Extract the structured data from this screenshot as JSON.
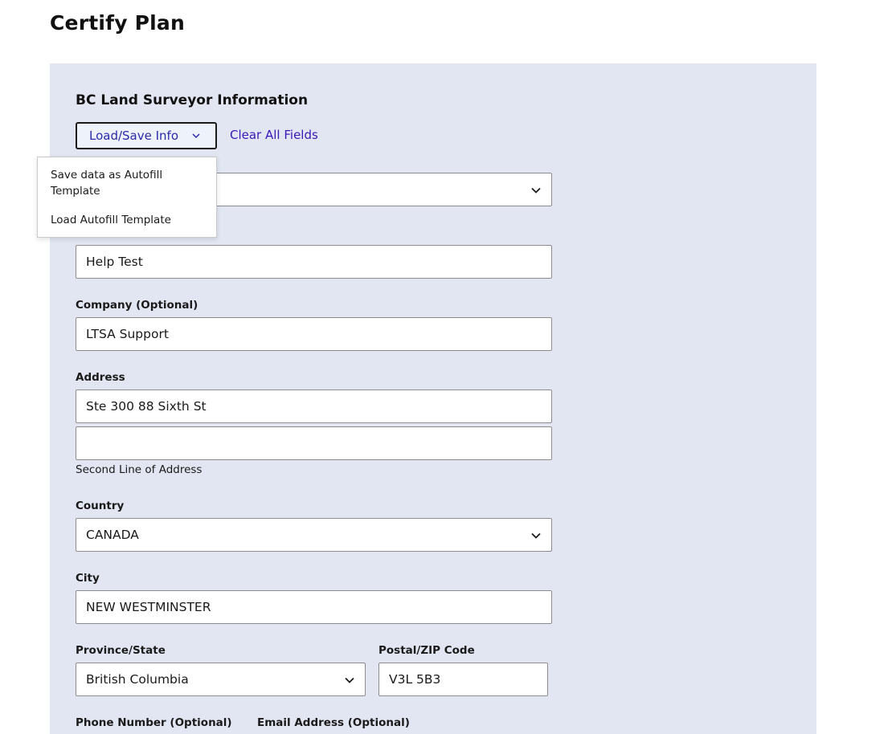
{
  "page": {
    "title": "Certify Plan"
  },
  "section": {
    "title": "BC Land Surveyor Information"
  },
  "toolbar": {
    "load_save_label": "Load/Save Info",
    "clear_all_label": "Clear All Fields"
  },
  "dropdown": {
    "items": [
      {
        "label": "Save data as Autofill Template"
      },
      {
        "label": "Load Autofill Template"
      }
    ]
  },
  "form": {
    "surveyor_select": {
      "value": ""
    },
    "name": {
      "value": "Help Test"
    },
    "company": {
      "label": "Company (Optional)",
      "value": "LTSA Support"
    },
    "address": {
      "label": "Address",
      "line1": "Ste 300 88 Sixth St",
      "line2": "",
      "helper": "Second Line of Address"
    },
    "country": {
      "label": "Country",
      "value": "CANADA"
    },
    "city": {
      "label": "City",
      "value": "NEW WESTMINSTER"
    },
    "province": {
      "label": "Province/State",
      "value": "British Columbia"
    },
    "postal": {
      "label": "Postal/ZIP Code",
      "value": "V3L 5B3"
    },
    "phone": {
      "label": "Phone Number (Optional)"
    },
    "email": {
      "label": "Email Address (Optional)"
    }
  },
  "icons": {
    "chevron": "chevron-down-icon"
  },
  "colors": {
    "panel_background": "#e1e6f2",
    "link": "#3b18b8",
    "button_text": "#2b2ba8"
  }
}
